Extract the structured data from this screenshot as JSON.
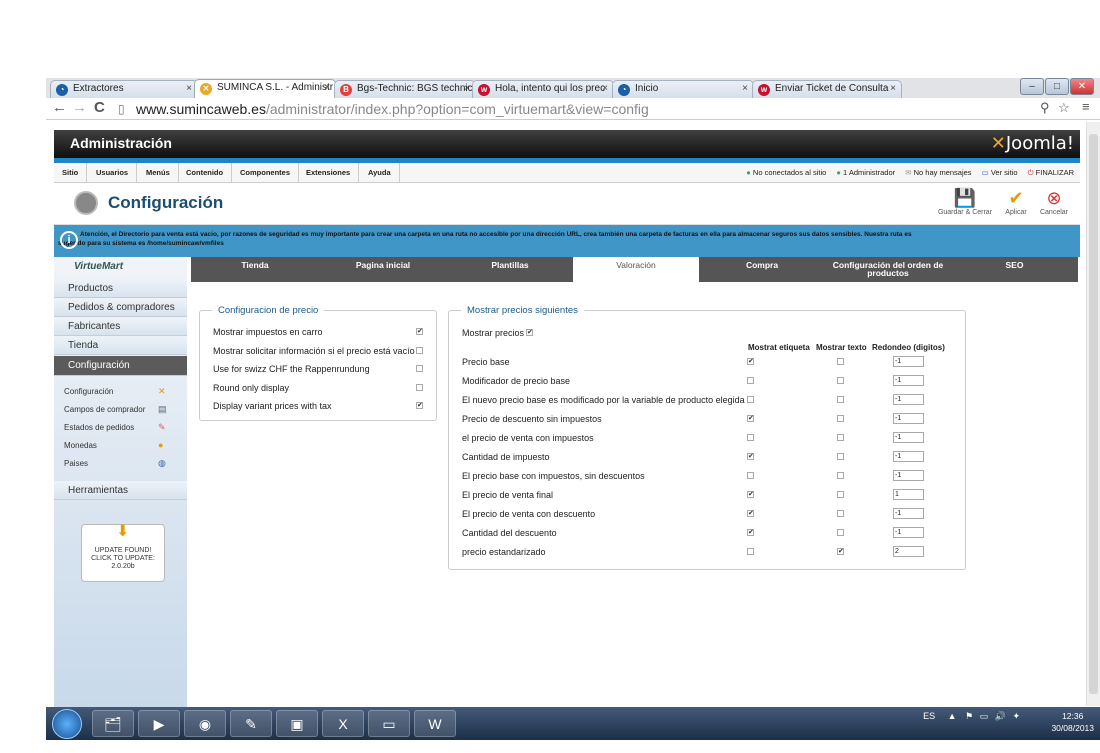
{
  "browser": {
    "tabs": [
      {
        "label": "Extractores",
        "icon_color": "#1b5fa8",
        "glyph": "◔"
      },
      {
        "label": "SUMINCA S.L. - Administr",
        "icon_color": "#e8a92a",
        "glyph": "✕",
        "active": true
      },
      {
        "label": "Bgs-Technic: BGS technic",
        "icon_color": "#e04040",
        "glyph": "B"
      },
      {
        "label": "Hola, intento qui los prec",
        "icon_color": "#c8102e",
        "glyph": "w"
      },
      {
        "label": "Inicio",
        "icon_color": "#1b5fa8",
        "glyph": "◔"
      },
      {
        "label": "Enviar Ticket de Consulta",
        "icon_color": "#c8102e",
        "glyph": "w"
      }
    ],
    "url_host": "www.sumincaweb.es",
    "url_path": "/administrator/index.php?option=com_virtuemart&view=config"
  },
  "admin": {
    "title": "Administración",
    "logo_text": "Joomla!",
    "menu": [
      "Sitio",
      "Usuarios",
      "Menús",
      "Contenido",
      "Componentes",
      "Extensiones",
      "Ayuda"
    ],
    "status": {
      "no_conectados": "No conectados al sitio",
      "administrador": "1 Administrador",
      "mensajes": "No hay mensajes",
      "ver_sitio": "Ver sitio",
      "finalizar": "FINALIZAR"
    },
    "page_title": "Configuración",
    "toolbar": {
      "guardar": "Guardar & Cerrar",
      "aplicar": "Aplicar",
      "cancelar": "Cancelar"
    },
    "notice_line1": "Atención, el Directorio para venta está vacío, por razones de seguridad es muy importante para crear una carpeta en una ruta no accesible por una dirección URL, crea también una carpeta de facturas en ella para almacenar seguros sus datos sensibles. Nuestra ruta es",
    "notice_line2": "sugerido para su sistema es /home/sumincaw/vmfiles"
  },
  "sidebar": {
    "logo": "VirtueMart",
    "sections": [
      "Productos",
      "Pedidos & compradores",
      "Fabricantes",
      "Tienda",
      "Configuración"
    ],
    "subitems": [
      "Configuración",
      "Campos de comprador",
      "Estados de pedidos",
      "Monedas",
      "Paises"
    ],
    "tools": "Herramientas",
    "update_line1": "UPDATE FOUND!",
    "update_line2": "CLICK TO UPDATE:",
    "update_version": "2.0.20b"
  },
  "content": {
    "tabs": [
      "Tienda",
      "Pagina inicial",
      "Plantillas",
      "Valoración",
      "Compra",
      "Configuración del orden de productos",
      "SEO"
    ],
    "active_tab_index": 3,
    "precio_legend": "Configuracion de precio",
    "precio_rows": [
      {
        "label": "Mostrar impuestos en carro",
        "checked": true
      },
      {
        "label": "Mostrar solicitar información si el precio está vacío",
        "checked": false
      },
      {
        "label": "Use for swizz CHF the Rappenrundung",
        "checked": false
      },
      {
        "label": "Round only display",
        "checked": false
      },
      {
        "label": "Display variant prices with tax",
        "checked": true
      }
    ],
    "mostrar_legend": "Mostrar precios siguientes",
    "mostrar_precios_label": "Mostrar precios",
    "mostrar_precios_checked": true,
    "headers": {
      "etiqueta": "Mostrat etiqueta",
      "texto": "Mostrar texto",
      "redondeo": "Redondeo (digitos)"
    },
    "price_rows": [
      {
        "label": "Precio base",
        "etiqueta": true,
        "texto": false,
        "redondeo": "-1"
      },
      {
        "label": "Modificador de precio base",
        "etiqueta": false,
        "texto": false,
        "redondeo": "-1"
      },
      {
        "label": "El nuevo precio base es modificado por la variable de producto elegida",
        "etiqueta": false,
        "texto": false,
        "redondeo": "-1"
      },
      {
        "label": "Precio de descuento sin impuestos",
        "etiqueta": true,
        "texto": false,
        "redondeo": "-1"
      },
      {
        "label": "el precio de venta con impuestos",
        "etiqueta": false,
        "texto": false,
        "redondeo": "-1"
      },
      {
        "label": "Cantidad de impuesto",
        "etiqueta": true,
        "texto": false,
        "redondeo": "-1"
      },
      {
        "label": "El precio base con impuestos, sin descuentos",
        "etiqueta": false,
        "texto": false,
        "redondeo": "-1"
      },
      {
        "label": "El precio de venta final",
        "etiqueta": true,
        "texto": false,
        "redondeo": "1"
      },
      {
        "label": "El precio de venta con descuento",
        "etiqueta": true,
        "texto": false,
        "redondeo": "-1"
      },
      {
        "label": "Cantidad del descuento",
        "etiqueta": true,
        "texto": false,
        "redondeo": "-1"
      },
      {
        "label": "precio estandarizado",
        "etiqueta": false,
        "texto": true,
        "redondeo": "2"
      }
    ]
  },
  "taskbar": {
    "lang": "ES",
    "time": "12:36",
    "date": "30/08/2013"
  }
}
